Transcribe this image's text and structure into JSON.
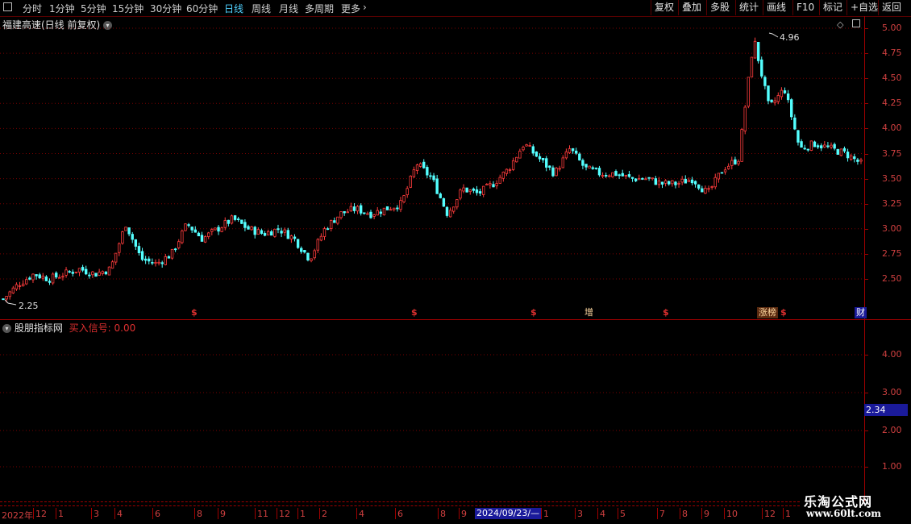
{
  "toolbar": {
    "periods": [
      {
        "label": "分时",
        "active": false
      },
      {
        "label": "1分钟",
        "active": false
      },
      {
        "label": "5分钟",
        "active": false
      },
      {
        "label": "15分钟",
        "active": false
      },
      {
        "label": "30分钟",
        "active": false
      },
      {
        "label": "60分钟",
        "active": false
      },
      {
        "label": "日线",
        "active": true
      },
      {
        "label": "周线",
        "active": false
      },
      {
        "label": "月线",
        "active": false
      },
      {
        "label": "多周期",
        "active": false
      },
      {
        "label": "更多",
        "active": false
      }
    ],
    "more_arrow": "›",
    "right_buttons": [
      "复权",
      "叠加",
      "多股",
      "统计",
      "画线",
      "F10",
      "标记",
      "+自选",
      "返回"
    ]
  },
  "main_panel": {
    "title": "福建高速(日线 前复权)",
    "dropdown_icon": "chevron-down-icon",
    "max_label": "4.96",
    "min_label": "2.25",
    "y_ticks": [
      "5.00",
      "4.75",
      "4.50",
      "4.25",
      "4.00",
      "3.75",
      "3.50",
      "3.25",
      "3.00",
      "2.75",
      "2.50"
    ],
    "signals": [
      {
        "label": "$",
        "type": "dollar"
      },
      {
        "label": "$",
        "type": "dollar"
      },
      {
        "label": "$",
        "type": "dollar"
      },
      {
        "label": "增",
        "type": "box"
      },
      {
        "label": "$",
        "type": "dollar"
      },
      {
        "label": "涨榜",
        "type": "box"
      },
      {
        "label": "$",
        "type": "dollar"
      },
      {
        "label": "财",
        "type": "box"
      }
    ]
  },
  "indicator_panel": {
    "name": "股朋指标网",
    "signal_label": "买入信号: 0.00",
    "y_ticks": [
      "4.00",
      "3.00",
      "2.00",
      "1.00"
    ],
    "current_value": "2.34"
  },
  "x_axis": {
    "labels": [
      "2022年",
      "12",
      "1",
      "3",
      "4",
      "6",
      "8",
      "9",
      "11",
      "12",
      "1",
      "2",
      "4",
      "6",
      "8",
      "9",
      "1",
      "3",
      "4",
      "5",
      "7",
      "8",
      "9",
      "10",
      "12",
      "1"
    ],
    "cursor_date": "2024/09/23/—"
  },
  "watermark": {
    "title": "乐淘公式网",
    "url": "www.60lt.com"
  },
  "chart_data": {
    "type": "candlestick",
    "title": "福建高速(日线 前复权)",
    "ylim": [
      2.2,
      5.05
    ],
    "y_ticks": [
      5.0,
      4.75,
      4.5,
      4.25,
      4.0,
      3.75,
      3.5,
      3.25,
      3.0,
      2.75,
      2.5
    ],
    "high": 4.96,
    "low": 2.25,
    "close_path": [
      2.3,
      2.45,
      2.55,
      2.5,
      2.55,
      2.6,
      2.55,
      2.6,
      3.05,
      2.7,
      2.65,
      2.75,
      3.05,
      2.9,
      3.0,
      3.1,
      3.0,
      2.95,
      3.0,
      2.9,
      2.7,
      3.0,
      3.15,
      3.2,
      3.15,
      3.2,
      3.25,
      3.65,
      3.5,
      3.15,
      3.4,
      3.35,
      3.45,
      3.6,
      3.85,
      3.7,
      3.55,
      3.8,
      3.6,
      3.55,
      3.55,
      3.5,
      3.5,
      3.45,
      3.45,
      3.5,
      3.35,
      3.6,
      3.7,
      4.9,
      4.2,
      4.4,
      3.8,
      3.85,
      3.8,
      3.75,
      3.65
    ]
  }
}
